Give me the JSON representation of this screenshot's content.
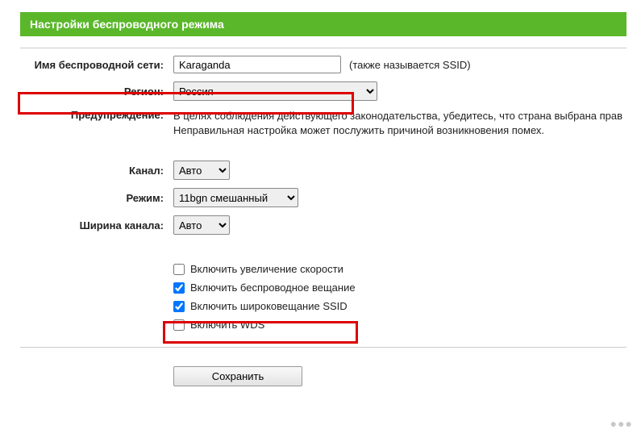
{
  "header": {
    "title": "Настройки беспроводного режима"
  },
  "form": {
    "ssid": {
      "label": "Имя беспроводной сети:",
      "value": "Karaganda",
      "hint": "(также называется SSID)"
    },
    "region": {
      "label": "Регион:",
      "value": "Россия"
    },
    "warning": {
      "label": "Предупреждение:",
      "text": "В целях соблюдения действующего законодательства, убедитесь, что страна выбрана прав\nНеправильная настройка может послужить причиной возникновения помех."
    },
    "channel": {
      "label": "Канал:",
      "value": "Авто"
    },
    "mode": {
      "label": "Режим:",
      "value": "11bgn смешанный"
    },
    "channel_width": {
      "label": "Ширина канала:",
      "value": "Авто"
    },
    "checkboxes": {
      "speed_boost": {
        "label": "Включить увеличение скорости",
        "checked": false
      },
      "wireless_enable": {
        "label": "Включить беспроводное вещание",
        "checked": true
      },
      "ssid_broadcast": {
        "label": "Включить широковещание SSID",
        "checked": true
      },
      "wds": {
        "label": "Включить WDS",
        "checked": false
      }
    },
    "save": {
      "label": "Сохранить"
    }
  }
}
